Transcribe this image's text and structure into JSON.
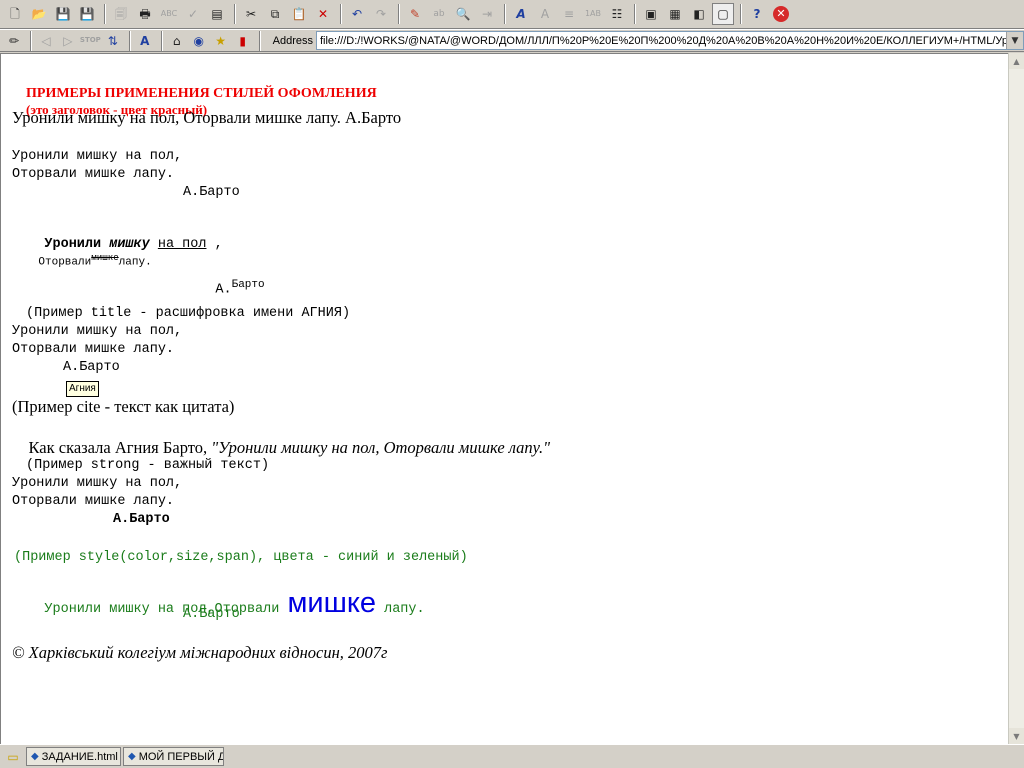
{
  "address_bar": {
    "label": "Address",
    "url": "file:///D:/!WORKS/@NATA/@WORD/ДОМ/ЛЛЛ/П%20Р%20Е%20П%200%20Д%20А%20В%20А%20Н%20И%20Е/КОЛЛЕГИУМ+/HTML/Уро"
  },
  "toolbar1": {
    "icons": [
      "new-icon",
      "open-icon",
      "save-icon",
      "save-all-icon",
      "print-preview-icon",
      "print-icon",
      "spellcheck-icon",
      "check-icon",
      "page-icon",
      "cut-icon",
      "copy-icon",
      "paste-icon",
      "delete-icon",
      "undo-icon",
      "redo-icon",
      "bookmark-icon",
      "replace-icon",
      "find-icon",
      "insert-icon",
      "font-icon",
      "format-icon",
      "indent-icon",
      "numbering-icon",
      "properties-icon",
      "view1-icon",
      "view2-icon",
      "view3-icon",
      "view4-icon",
      "help-icon",
      "close-red-icon"
    ]
  },
  "toolbar2": {
    "icons": [
      "edit-pencil-icon",
      "back-icon",
      "forward-icon",
      "stop-icon",
      "refresh-icon",
      "font-size-icon",
      "home-icon",
      "search-globe-icon",
      "favorites-icon",
      "bookmark-red-icon"
    ]
  },
  "document": {
    "heading_main": "ПРИМЕРЫ ПРИМЕНЕНИЯ СТИЛЕЙ ОФОМЛЕНИЯ",
    "heading_note": "(это заголовок - цвет красный)",
    "poem_serif": "Уронили мишку на пол, Оторвали мишке лапу. А.Барто",
    "pre_block_1": {
      "line1": "Уронили мишку на пол,",
      "line2": "Оторвали мишке лапу.",
      "line3": "А.Барто"
    },
    "styled_block": {
      "line1_bold": "Уронили",
      "line1_bold_italic": "мишку",
      "line1_underline": "на пол",
      "line1_comma": " ,",
      "line2_small": "Оторвали",
      "line2_strike_sup": "мишке",
      "line2_small_end": "лапу.",
      "line3_author": "А.",
      "line3_author_sup": "Барто"
    },
    "title_example": {
      "caption": "(Пример title - расшифровка имени АГНИЯ)",
      "line1": "Уронили мишку на пол,",
      "line2": "Оторвали мишке лапу.",
      "line3": "А.Барто",
      "tooltip": "Агния"
    },
    "cite_example": {
      "caption": "(Пример cite - текст как цитата)",
      "prefix": "Как сказала Агния Барто, ",
      "quote": "\"Уронили мишку на пол, Оторвали мишке лапу.\""
    },
    "strong_example": {
      "caption": "(Пример strong - важный текст)",
      "line1": "Уронили мишку на пол,",
      "line2": "Оторвали мишке лапу.",
      "line3": "А.Барто"
    },
    "style_example": {
      "caption": "(Пример style(color,size,span), цвета - синий и зеленый)",
      "line1_start": "Уронили мишку на пол,Оторвали ",
      "line1_big": "мишке",
      "line1_end": " лапу.",
      "line2": "А.Барто",
      "colors": {
        "green": "#1a7c1a",
        "blue": "#0000e0",
        "red_heading": "#e00000"
      }
    },
    "copyright": "© Харківський колегіум міжнародних відносин, 2007г"
  },
  "taskbar": {
    "tabs": [
      {
        "label": "ЗАДАНИЕ.html"
      },
      {
        "label": "МОЙ ПЕРВЫЙ ДОК"
      }
    ]
  }
}
